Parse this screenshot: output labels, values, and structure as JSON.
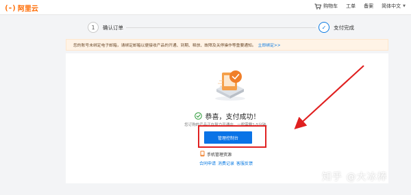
{
  "header": {
    "logo_mark": "(-)",
    "logo_text": "阿里云",
    "nav": {
      "cart": "购物车",
      "orders": "工单",
      "filing": "备案",
      "language": "简体中文"
    }
  },
  "steps": [
    {
      "number": "1",
      "label": "确认订单"
    },
    {
      "number": "✓",
      "label": "支付完成"
    }
  ],
  "notice": {
    "text": "您的账号未绑定电子邮箱，请绑定邮箱以便接收产品的开通、到期、释放、故障及关停操作等重要通知。",
    "link": "立即绑定>>"
  },
  "result": {
    "title": "恭喜，支付成功！",
    "description": "您订购的产品正在努力开通中，一般需要1-5分钟。",
    "primary_button": "管理控制台",
    "mobile_link": "手机管理资源",
    "links": [
      "合同申请",
      "消费记录",
      "客服反馈"
    ]
  },
  "watermark": "知乎 @大冰棒",
  "colors": {
    "brand": "#ff6a00",
    "primary": "#0a73e6",
    "link": "#0a7ae2",
    "annotation": "#e02020",
    "success": "#2e9b3a"
  }
}
